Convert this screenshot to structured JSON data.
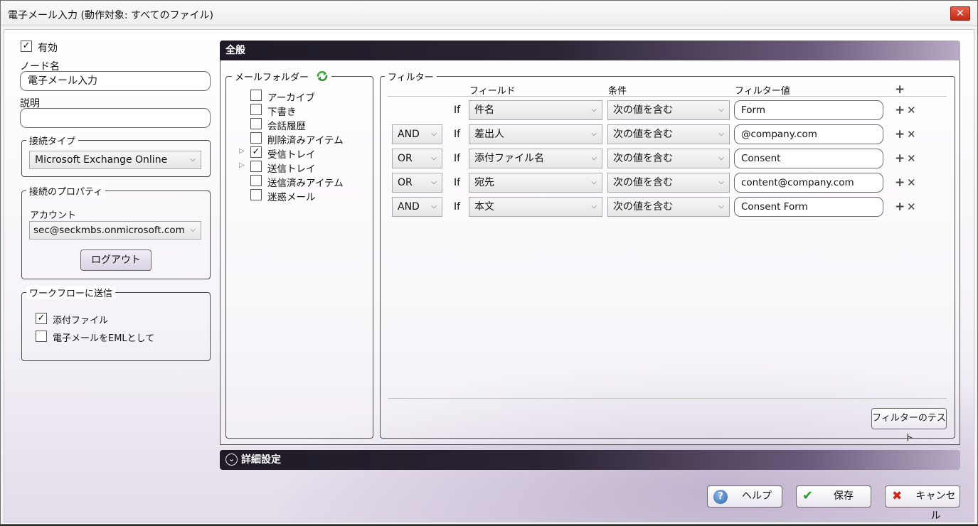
{
  "window": {
    "title": "電子メール入力 (動作対象: すべてのファイル)",
    "close": "✕"
  },
  "left": {
    "enabled_label": "有効",
    "enabled_checked": "✓",
    "node_name_label": "ノード名",
    "node_name_value": "電子メール入力",
    "description_label": "説明",
    "description_value": "",
    "conn_type_legend": "接続タイプ",
    "conn_type_value": "Microsoft Exchange Online",
    "conn_props_legend": "接続のプロパティ",
    "account_label": "アカウント",
    "account_value": "sec@seckmbs.onmicrosoft.com",
    "logout_label": "ログアウト",
    "send_legend": "ワークフローに送信",
    "attach_label": "添付ファイル",
    "attach_checked": "✓",
    "eml_label": "電子メールをEMLとして",
    "eml_checked": ""
  },
  "general": {
    "header": "全般"
  },
  "folders": {
    "legend": "メールフォルダー",
    "items": [
      {
        "label": "アーカイブ",
        "checked": "",
        "expander": ""
      },
      {
        "label": "下書き",
        "checked": "",
        "expander": ""
      },
      {
        "label": "会話履歴",
        "checked": "",
        "expander": ""
      },
      {
        "label": "削除済みアイテム",
        "checked": "",
        "expander": ""
      },
      {
        "label": "受信トレイ",
        "checked": "✓",
        "expander": "▷"
      },
      {
        "label": "送信トレイ",
        "checked": "",
        "expander": "▷"
      },
      {
        "label": "送信済みアイテム",
        "checked": "",
        "expander": ""
      },
      {
        "label": "迷惑メール",
        "checked": "",
        "expander": ""
      }
    ]
  },
  "filters": {
    "legend": "フィルター",
    "col_field": "フィールド",
    "col_condition": "条件",
    "col_value": "フィルター値",
    "add_icon": "+",
    "remove_icon": "✕",
    "rows": [
      {
        "logic": "",
        "if": "If",
        "field": "件名",
        "condition": "次の値を含む",
        "value": "Form"
      },
      {
        "logic": "AND",
        "if": "If",
        "field": "差出人",
        "condition": "次の値を含む",
        "value": "@company.com"
      },
      {
        "logic": "OR",
        "if": "If",
        "field": "添付ファイル名",
        "condition": "次の値を含む",
        "value": "Consent"
      },
      {
        "logic": "OR",
        "if": "If",
        "field": "宛先",
        "condition": "次の値を含む",
        "value": "content@company.com"
      },
      {
        "logic": "AND",
        "if": "If",
        "field": "本文",
        "condition": "次の値を含む",
        "value": "Consent Form"
      }
    ],
    "test_button": "フィルターのテスト"
  },
  "advanced": {
    "header": "詳細設定",
    "icon": "⌄"
  },
  "footer": {
    "help": "ヘルプ",
    "help_icon": "?",
    "save": "保存",
    "save_icon": "✔",
    "cancel": "キャンセル",
    "cancel_icon": "✖"
  }
}
